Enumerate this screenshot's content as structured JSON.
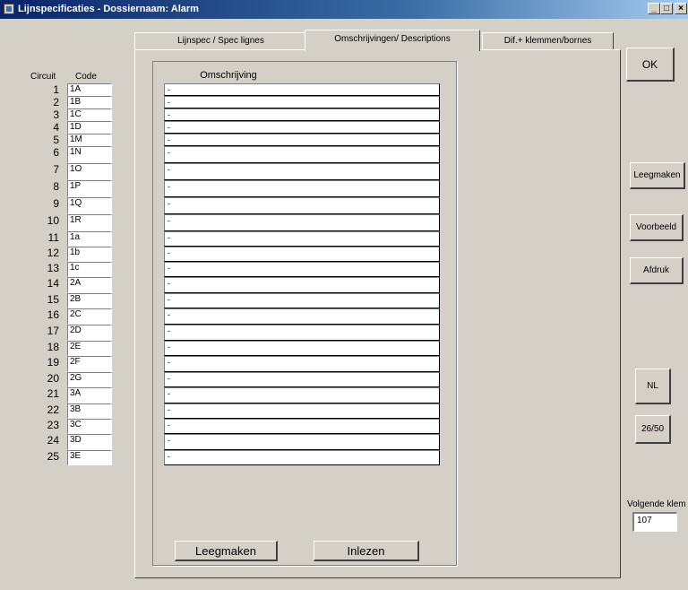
{
  "window": {
    "title": "Lijnspecificaties - Dossiernaam: Alarm",
    "controls": {
      "minimize": "_",
      "maximize": "□",
      "close": "×"
    }
  },
  "tabs": [
    {
      "label": "Lijnspec / Spec lignes",
      "active": false
    },
    {
      "label": "Omschrijvingen/ Descriptions",
      "active": true
    },
    {
      "label": "Dif.+ klemmen/bornes",
      "active": false
    }
  ],
  "circuits": {
    "header_circuit": "Circuit",
    "header_code": "Code",
    "rows": [
      {
        "num": "1",
        "code": "1A"
      },
      {
        "num": "2",
        "code": "1B"
      },
      {
        "num": "3",
        "code": "1C"
      },
      {
        "num": "4",
        "code": "1D"
      },
      {
        "num": "5",
        "code": "1M"
      },
      {
        "num": "6",
        "code": "1N"
      },
      {
        "num": "7",
        "code": "1O"
      },
      {
        "num": "8",
        "code": "1P"
      },
      {
        "num": "9",
        "code": "1Q"
      },
      {
        "num": "10",
        "code": "1R"
      },
      {
        "num": "11",
        "code": "1a"
      },
      {
        "num": "12",
        "code": "1b"
      },
      {
        "num": "13",
        "code": "1c"
      },
      {
        "num": "14",
        "code": "2A"
      },
      {
        "num": "15",
        "code": "2B"
      },
      {
        "num": "16",
        "code": "2C"
      },
      {
        "num": "17",
        "code": "2D"
      },
      {
        "num": "18",
        "code": "2E"
      },
      {
        "num": "19",
        "code": "2F"
      },
      {
        "num": "20",
        "code": "2G"
      },
      {
        "num": "21",
        "code": "3A"
      },
      {
        "num": "22",
        "code": "3B"
      },
      {
        "num": "23",
        "code": "3C"
      },
      {
        "num": "24",
        "code": "3D"
      },
      {
        "num": "25",
        "code": "3E"
      }
    ]
  },
  "descriptions": {
    "title": "Omschrijving",
    "fields": [
      "-",
      "-",
      "-",
      "-",
      "-",
      "-",
      "-",
      "-",
      "-",
      "-",
      "-",
      "-",
      "-",
      "-",
      "-",
      "-",
      "-",
      "-",
      "-",
      "-",
      "-",
      "-",
      "-",
      "-",
      "-"
    ],
    "clear_button": "Leegmaken",
    "load_button": "Inlezen"
  },
  "side": {
    "ok": "OK",
    "clear": "Leegmaken",
    "preview": "Voorbeeld",
    "print": "Afdruk",
    "language": "NL",
    "frequency": "26/50",
    "next_label": "Volgende klem",
    "next_value": "107"
  }
}
